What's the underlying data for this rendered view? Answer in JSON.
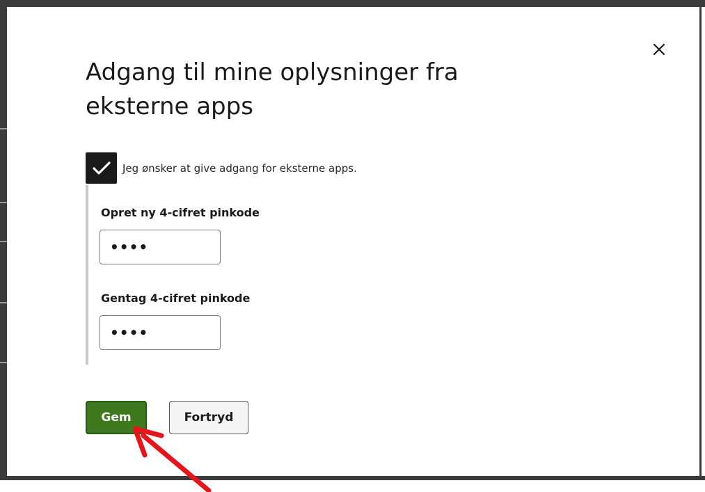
{
  "modal": {
    "title": "Adgang til mine oplysninger fra eksterne apps",
    "close_icon": "close-icon",
    "consent": {
      "checked": true,
      "label": "Jeg ønsker at give adgang for eksterne apps."
    },
    "new_pin": {
      "label": "Opret ny 4-cifret pinkode",
      "value": "••••"
    },
    "repeat_pin": {
      "label": "Gentag 4-cifret pinkode",
      "value": "••••"
    },
    "buttons": {
      "save_label": "Gem",
      "cancel_label": "Fortryd"
    }
  },
  "colors": {
    "save_button": "#3d7a1e",
    "checkbox": "#1a1a1a",
    "annotation_arrow": "#e8141c"
  }
}
